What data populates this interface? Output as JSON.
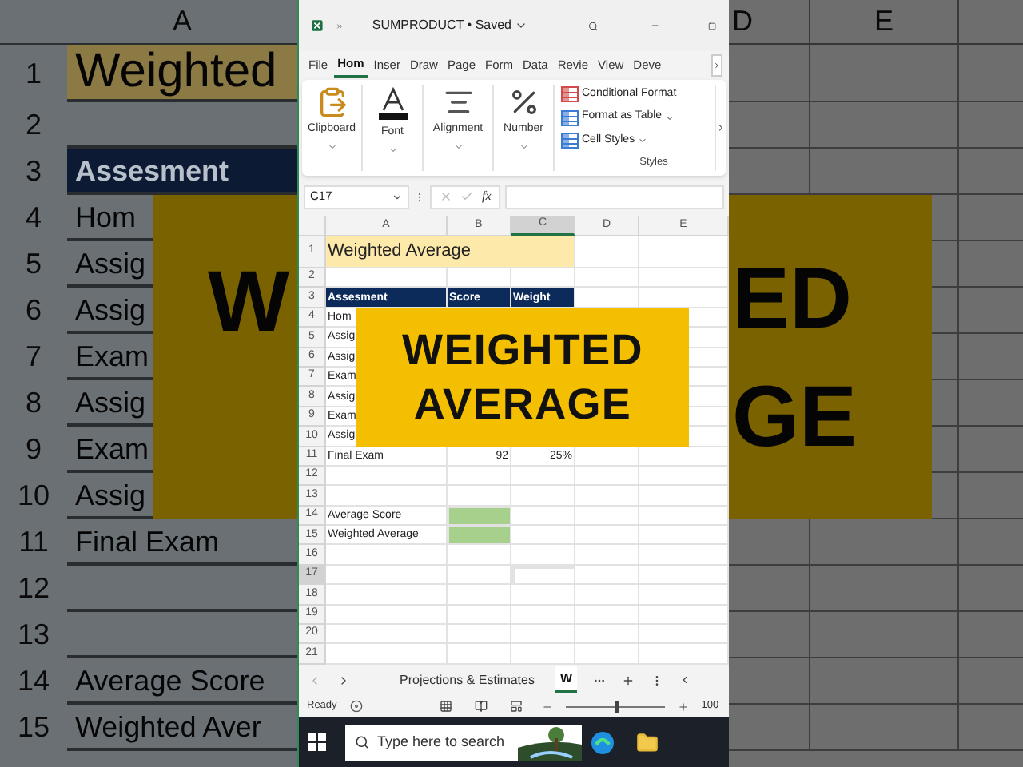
{
  "background": {
    "left": {
      "column_header": "A",
      "rows": [
        {
          "number": "1",
          "text": "Weighted",
          "kind": "title"
        },
        {
          "number": "2",
          "kind": "empty"
        },
        {
          "number": "3",
          "text": "Assesment",
          "kind": "header"
        },
        {
          "number": "4",
          "text": "Hom",
          "kind": "data"
        },
        {
          "number": "5",
          "text": "Assig",
          "kind": "data"
        },
        {
          "number": "6",
          "text": "Assig",
          "kind": "data"
        },
        {
          "number": "7",
          "text": "Exam",
          "kind": "data"
        },
        {
          "number": "8",
          "text": "Assig",
          "kind": "data"
        },
        {
          "number": "9",
          "text": "Exam",
          "kind": "data"
        },
        {
          "number": "10",
          "text": "Assig",
          "kind": "data"
        },
        {
          "number": "11",
          "text": "Final Exam",
          "kind": "data"
        },
        {
          "number": "12",
          "kind": "empty"
        },
        {
          "number": "13",
          "kind": "empty"
        },
        {
          "number": "14",
          "text": "Average Score",
          "kind": "data"
        },
        {
          "number": "15",
          "text": "Weighted Aver",
          "kind": "data"
        }
      ],
      "banner": [
        "W"
      ]
    },
    "right": {
      "column_headers": [
        "D",
        "E"
      ],
      "banner": [
        "ED",
        "GE"
      ]
    }
  },
  "window": {
    "title": "SUMPRODUCT • Saved",
    "ribbon_tabs": [
      {
        "label": "File",
        "selected": false
      },
      {
        "label": "Hom",
        "selected": true
      },
      {
        "label": "Inser",
        "selected": false
      },
      {
        "label": "Draw",
        "selected": false
      },
      {
        "label": "Page",
        "selected": false
      },
      {
        "label": "Form",
        "selected": false
      },
      {
        "label": "Data",
        "selected": false
      },
      {
        "label": "Revie",
        "selected": false
      },
      {
        "label": "View",
        "selected": false
      },
      {
        "label": "Deve",
        "selected": false
      }
    ],
    "ribbon_groups": [
      {
        "label": "Clipboard",
        "kind": "clipboard"
      },
      {
        "label": "Font",
        "kind": "font"
      },
      {
        "label": "Alignment",
        "kind": "alignment"
      },
      {
        "label": "Number",
        "kind": "number"
      }
    ],
    "styles": {
      "items": [
        {
          "label": "Conditional Format",
          "dropdown": false
        },
        {
          "label": "Format as Table",
          "dropdown": true
        },
        {
          "label": "Cell Styles",
          "dropdown": true
        }
      ],
      "label": "Styles"
    },
    "formula_bar": {
      "name_box": "C17",
      "function_label": "fx"
    },
    "columns": [
      {
        "label": "A",
        "selected": false
      },
      {
        "label": "B",
        "selected": false
      },
      {
        "label": "C",
        "selected": true
      },
      {
        "label": "D",
        "selected": false
      },
      {
        "label": "E",
        "selected": false
      }
    ],
    "rows": [
      {
        "number": "1",
        "kind": "title",
        "cells": [
          "Weighted Average"
        ],
        "selected": false
      },
      {
        "number": "2",
        "kind": "empty",
        "cells": [],
        "selected": false
      },
      {
        "number": "3",
        "kind": "header",
        "cells": [
          "Assesment",
          "Score",
          "Weight"
        ],
        "selected": false
      },
      {
        "number": "4",
        "kind": "data",
        "cells": [
          "Hom"
        ],
        "selected": false
      },
      {
        "number": "5",
        "kind": "data",
        "cells": [
          "Assig"
        ],
        "selected": false
      },
      {
        "number": "6",
        "kind": "data",
        "cells": [
          "Assig"
        ],
        "selected": false
      },
      {
        "number": "7",
        "kind": "data",
        "cells": [
          "Exam"
        ],
        "selected": false
      },
      {
        "number": "8",
        "kind": "data",
        "cells": [
          "Assig"
        ],
        "selected": false
      },
      {
        "number": "9",
        "kind": "data",
        "cells": [
          "Exam"
        ],
        "selected": false
      },
      {
        "number": "10",
        "kind": "data",
        "cells": [
          "Assig"
        ],
        "selected": false
      },
      {
        "number": "11",
        "kind": "data",
        "cells": [
          "Final Exam",
          "92",
          "25%"
        ],
        "selected": false
      },
      {
        "number": "12",
        "kind": "empty",
        "cells": [],
        "selected": false
      },
      {
        "number": "13",
        "kind": "empty",
        "cells": [],
        "selected": false
      },
      {
        "number": "14",
        "kind": "summary",
        "cells": [
          "Average Score"
        ],
        "selected": false
      },
      {
        "number": "15",
        "kind": "summary",
        "cells": [
          "Weighted Average"
        ],
        "selected": false
      },
      {
        "number": "16",
        "kind": "empty",
        "cells": [],
        "selected": false
      },
      {
        "number": "17",
        "kind": "empty",
        "cells": [],
        "selected": true
      },
      {
        "number": "18",
        "kind": "empty",
        "cells": [],
        "selected": false
      },
      {
        "number": "19",
        "kind": "empty",
        "cells": [],
        "selected": false
      },
      {
        "number": "20",
        "kind": "empty",
        "cells": [],
        "selected": false
      },
      {
        "number": "21",
        "kind": "empty",
        "cells": [],
        "selected": false
      }
    ],
    "banner": [
      "WEIGHTED",
      "AVERAGE"
    ],
    "sheet_tabs": [
      {
        "label": "Projections & Estimates",
        "selected": false
      },
      {
        "label": "W",
        "selected": true
      }
    ],
    "status": {
      "text": "Ready",
      "zoom": {
        "level": 0.5,
        "reading": "100"
      }
    },
    "taskbar": {
      "search_placeholder": "Type here to search"
    }
  }
}
